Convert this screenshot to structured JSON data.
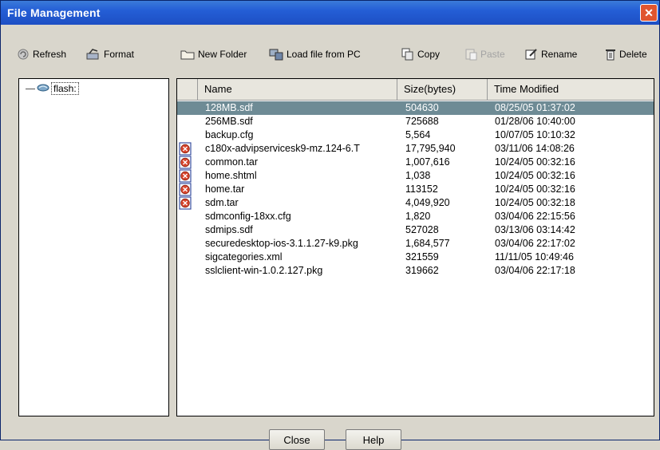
{
  "window": {
    "title": "File Management",
    "close_glyph": "✕"
  },
  "toolbar": {
    "refresh": "Refresh",
    "format": "Format",
    "new_folder": "New Folder",
    "load_file": "Load file from PC",
    "copy": "Copy",
    "paste": "Paste",
    "rename": "Rename",
    "delete": "Delete"
  },
  "tree": {
    "root_label": "flash:"
  },
  "table": {
    "columns": [
      "Name",
      "Size(bytes)",
      "Time Modified"
    ],
    "rows": [
      {
        "name": "128MB.sdf",
        "size": "504630",
        "time": "08/25/05 01:37:02",
        "selected": true,
        "icon": ""
      },
      {
        "name": "256MB.sdf",
        "size": "725688",
        "time": "01/28/06 10:40:00",
        "selected": false,
        "icon": ""
      },
      {
        "name": "backup.cfg",
        "size": "5,564",
        "time": "10/07/05 10:10:32",
        "selected": false,
        "icon": ""
      },
      {
        "name": "c180x-advipservicesk9-mz.124-6.T",
        "size": "17,795,940",
        "time": "03/11/06 14:08:26",
        "selected": false,
        "icon": "warning-file-icon"
      },
      {
        "name": "common.tar",
        "size": "1,007,616",
        "time": "10/24/05 00:32:16",
        "selected": false,
        "icon": "warning-file-icon"
      },
      {
        "name": "home.shtml",
        "size": "1,038",
        "time": "10/24/05 00:32:16",
        "selected": false,
        "icon": "warning-file-icon"
      },
      {
        "name": "home.tar",
        "size": "113152",
        "time": "10/24/05 00:32:16",
        "selected": false,
        "icon": "warning-file-icon"
      },
      {
        "name": "sdm.tar",
        "size": "4,049,920",
        "time": "10/24/05 00:32:18",
        "selected": false,
        "icon": "warning-file-icon"
      },
      {
        "name": "sdmconfig-18xx.cfg",
        "size": "1,820",
        "time": "03/04/06 22:15:56",
        "selected": false,
        "icon": ""
      },
      {
        "name": "sdmips.sdf",
        "size": "527028",
        "time": "03/13/06 03:14:42",
        "selected": false,
        "icon": ""
      },
      {
        "name": "securedesktop-ios-3.1.1.27-k9.pkg",
        "size": "1,684,577",
        "time": "03/04/06 22:17:02",
        "selected": false,
        "icon": ""
      },
      {
        "name": "sigcategories.xml",
        "size": "321559",
        "time": "11/11/05 10:49:46",
        "selected": false,
        "icon": ""
      },
      {
        "name": "sslclient-win-1.0.2.127.pkg",
        "size": "319662",
        "time": "03/04/06 22:17:18",
        "selected": false,
        "icon": ""
      }
    ]
  },
  "buttons": {
    "close": "Close",
    "help": "Help"
  },
  "colors": {
    "title_bar": "#245ed6",
    "selected_row": "#6e8b95",
    "dialog_bg": "#d9d6cc"
  }
}
